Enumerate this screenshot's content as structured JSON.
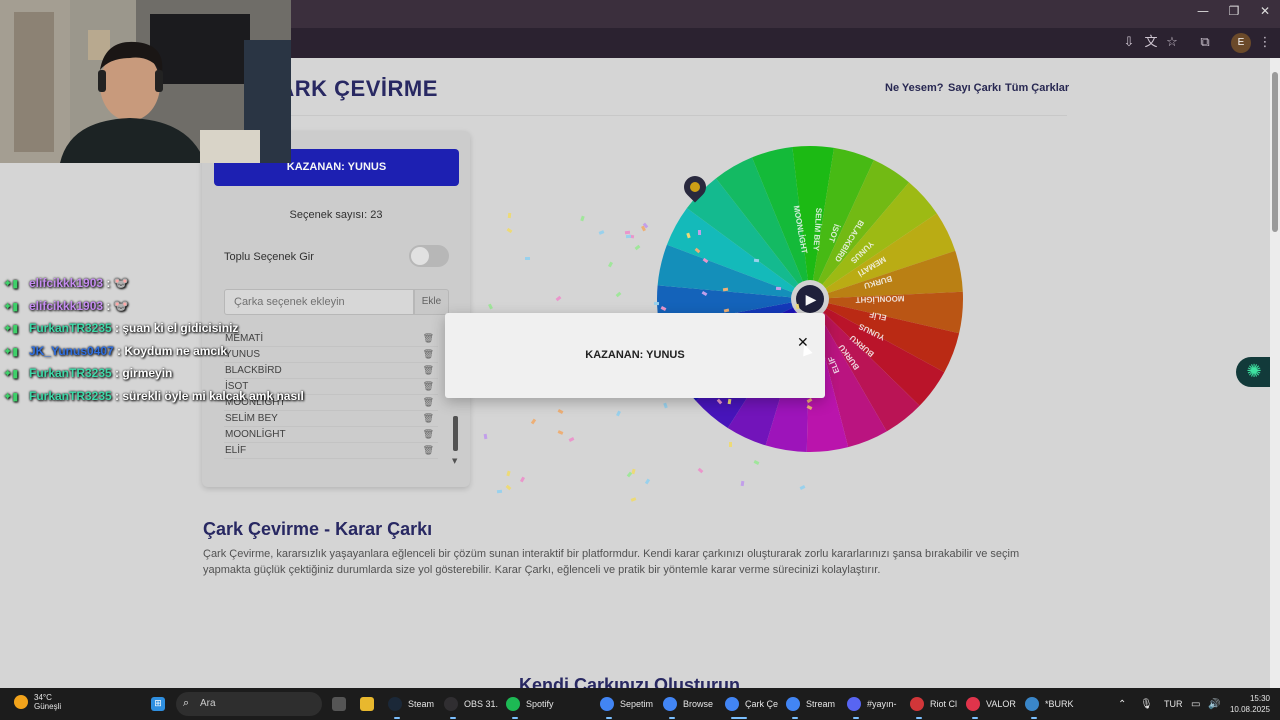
{
  "browser": {
    "window_controls": [
      "—",
      "❐",
      "✕"
    ]
  },
  "site": {
    "title": "ÇARK ÇEVİRME",
    "nav": [
      "Ne Yesem?",
      "Sayı Çarkı",
      "Tüm Çarklar"
    ]
  },
  "panel": {
    "winner_label": "KAZANAN: YUNUS",
    "option_count": "Seçenek sayısı: 23",
    "bulk_label": "Toplu Seçenek Gir",
    "input_placeholder": "Çarka seçenek ekleyin",
    "add_button": "Ekle",
    "options": [
      "MEMATİ",
      "YUNUS",
      "BLACKBİRD",
      "İSOT",
      "MOONLİGHT",
      "SELİM BEY",
      "MOONLİGHT",
      "ELİF"
    ]
  },
  "wheel": {
    "play_label": "▶",
    "visible_labels": [
      "MOONLİGHT",
      "SELİM BEY",
      "İSOT",
      "BLACKBİRD",
      "YUNUS",
      "MEMATİ",
      "BURKU",
      "MOONLİGHT",
      "ELİF",
      "YUNUS",
      "BURKU",
      "BURKU",
      "ELİF",
      "ELİF"
    ]
  },
  "modal": {
    "text": "KAZANAN: YUNUS",
    "close": "✕"
  },
  "content": {
    "heading": "Çark Çevirme - Karar Çarkı",
    "paragraph": "Çark Çevirme, kararsızlık yaşayanlara eğlenceli bir çözüm sunan interaktif bir platformdur. Kendi karar çarkınızı oluşturarak zorlu kararlarınızı şansa bırakabilir ve seçim yapmakta güçlük çektiğiniz durumlarda size yol gösterebilir. Karar Çarkı, eğlenceli ve pratik bir yöntemle karar verme sürecinizi kolaylaştırır.",
    "subheading": "Kendi Çarkınızı Oluşturun"
  },
  "chat": [
    {
      "user": "elifcikkk1903",
      "message": "🐭",
      "color": "#c58cf0"
    },
    {
      "user": "elifcikkk1903",
      "message": "🐭",
      "color": "#c58cf0"
    },
    {
      "user": "FurkanTR3235",
      "message": "şuan ki el gidicisiniz",
      "color": "#3ed9a8"
    },
    {
      "user": "JK_Yunus0407",
      "message": "Koydum ne amcık",
      "color": "#2f6fe0"
    },
    {
      "user": "FurkanTR3235",
      "message": "girmeyin",
      "color": "#3ed9a8"
    },
    {
      "user": "FurkanTR3235",
      "message": "sürekli öyle mi kalcak amk nasıl",
      "color": "#3ed9a8"
    }
  ],
  "taskbar": {
    "weather_temp": "34°C",
    "weather_desc": "Güneşli",
    "search_placeholder": "Ara",
    "apps": [
      "Steam",
      "OBS 31.",
      "Spotify",
      "Sepetim",
      "Browse",
      "Çark Çe",
      "Stream",
      "#yayın-",
      "Riot Cl",
      "VALOR",
      "*BURK"
    ],
    "lang": "TUR",
    "time": "15:30",
    "date": "10.08.2025"
  },
  "colors": {
    "accent": "#1e22b8",
    "heading": "#2a2a66"
  }
}
